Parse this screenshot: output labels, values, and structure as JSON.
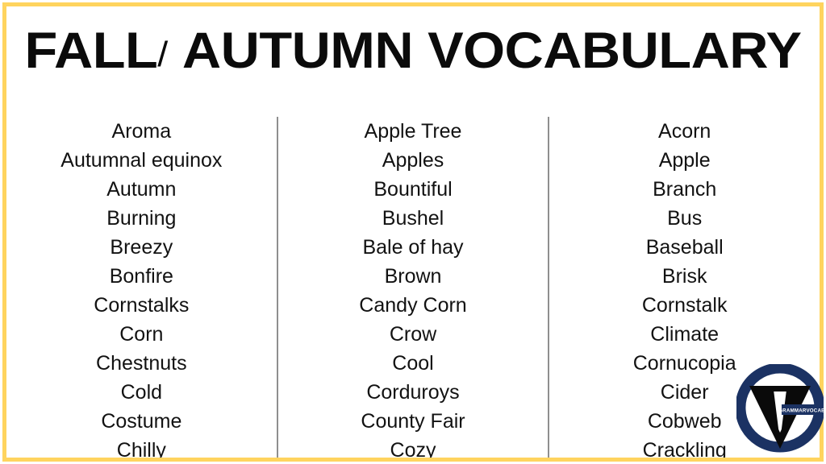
{
  "slide": {
    "title_main": "FALL",
    "title_slash": "/",
    "title_rest": " AUTUMN VOCABULARY",
    "title_full": "FALL/ AUTUMN VOCABULARY",
    "border_color": "#FFD45E",
    "background_color": "#FFFFFF",
    "divider_color": "#8F8F8F",
    "text_color": "#121212"
  },
  "columns": [
    {
      "id": "column-1",
      "words": [
        "Aroma",
        "Autumnal equinox",
        "Autumn",
        "Burning",
        "Breezy",
        "Bonfire",
        "Cornstalks",
        "Corn",
        "Chestnuts",
        "Cold",
        "Costume",
        "Chilly"
      ]
    },
    {
      "id": "column-2",
      "words": [
        "Apple Tree",
        "Apples",
        "Bountiful",
        "Bushel",
        "Bale of hay",
        "Brown",
        "Candy Corn",
        "Crow",
        "Cool",
        "Corduroys",
        "County Fair",
        "Cozy"
      ]
    },
    {
      "id": "column-3",
      "words": [
        "Acorn",
        "Apple",
        "Branch",
        "Bus",
        "Baseball",
        "Brisk",
        "Cornstalk",
        "Climate",
        "Cornucopia",
        "Cider",
        "Cobweb",
        "Crackling"
      ]
    }
  ],
  "logo": {
    "name": "grammarvocab-logo",
    "banner_text": "GRAMMARVOCAB",
    "ring_color": "#1B3263",
    "v_color": "#0A0A0A"
  }
}
